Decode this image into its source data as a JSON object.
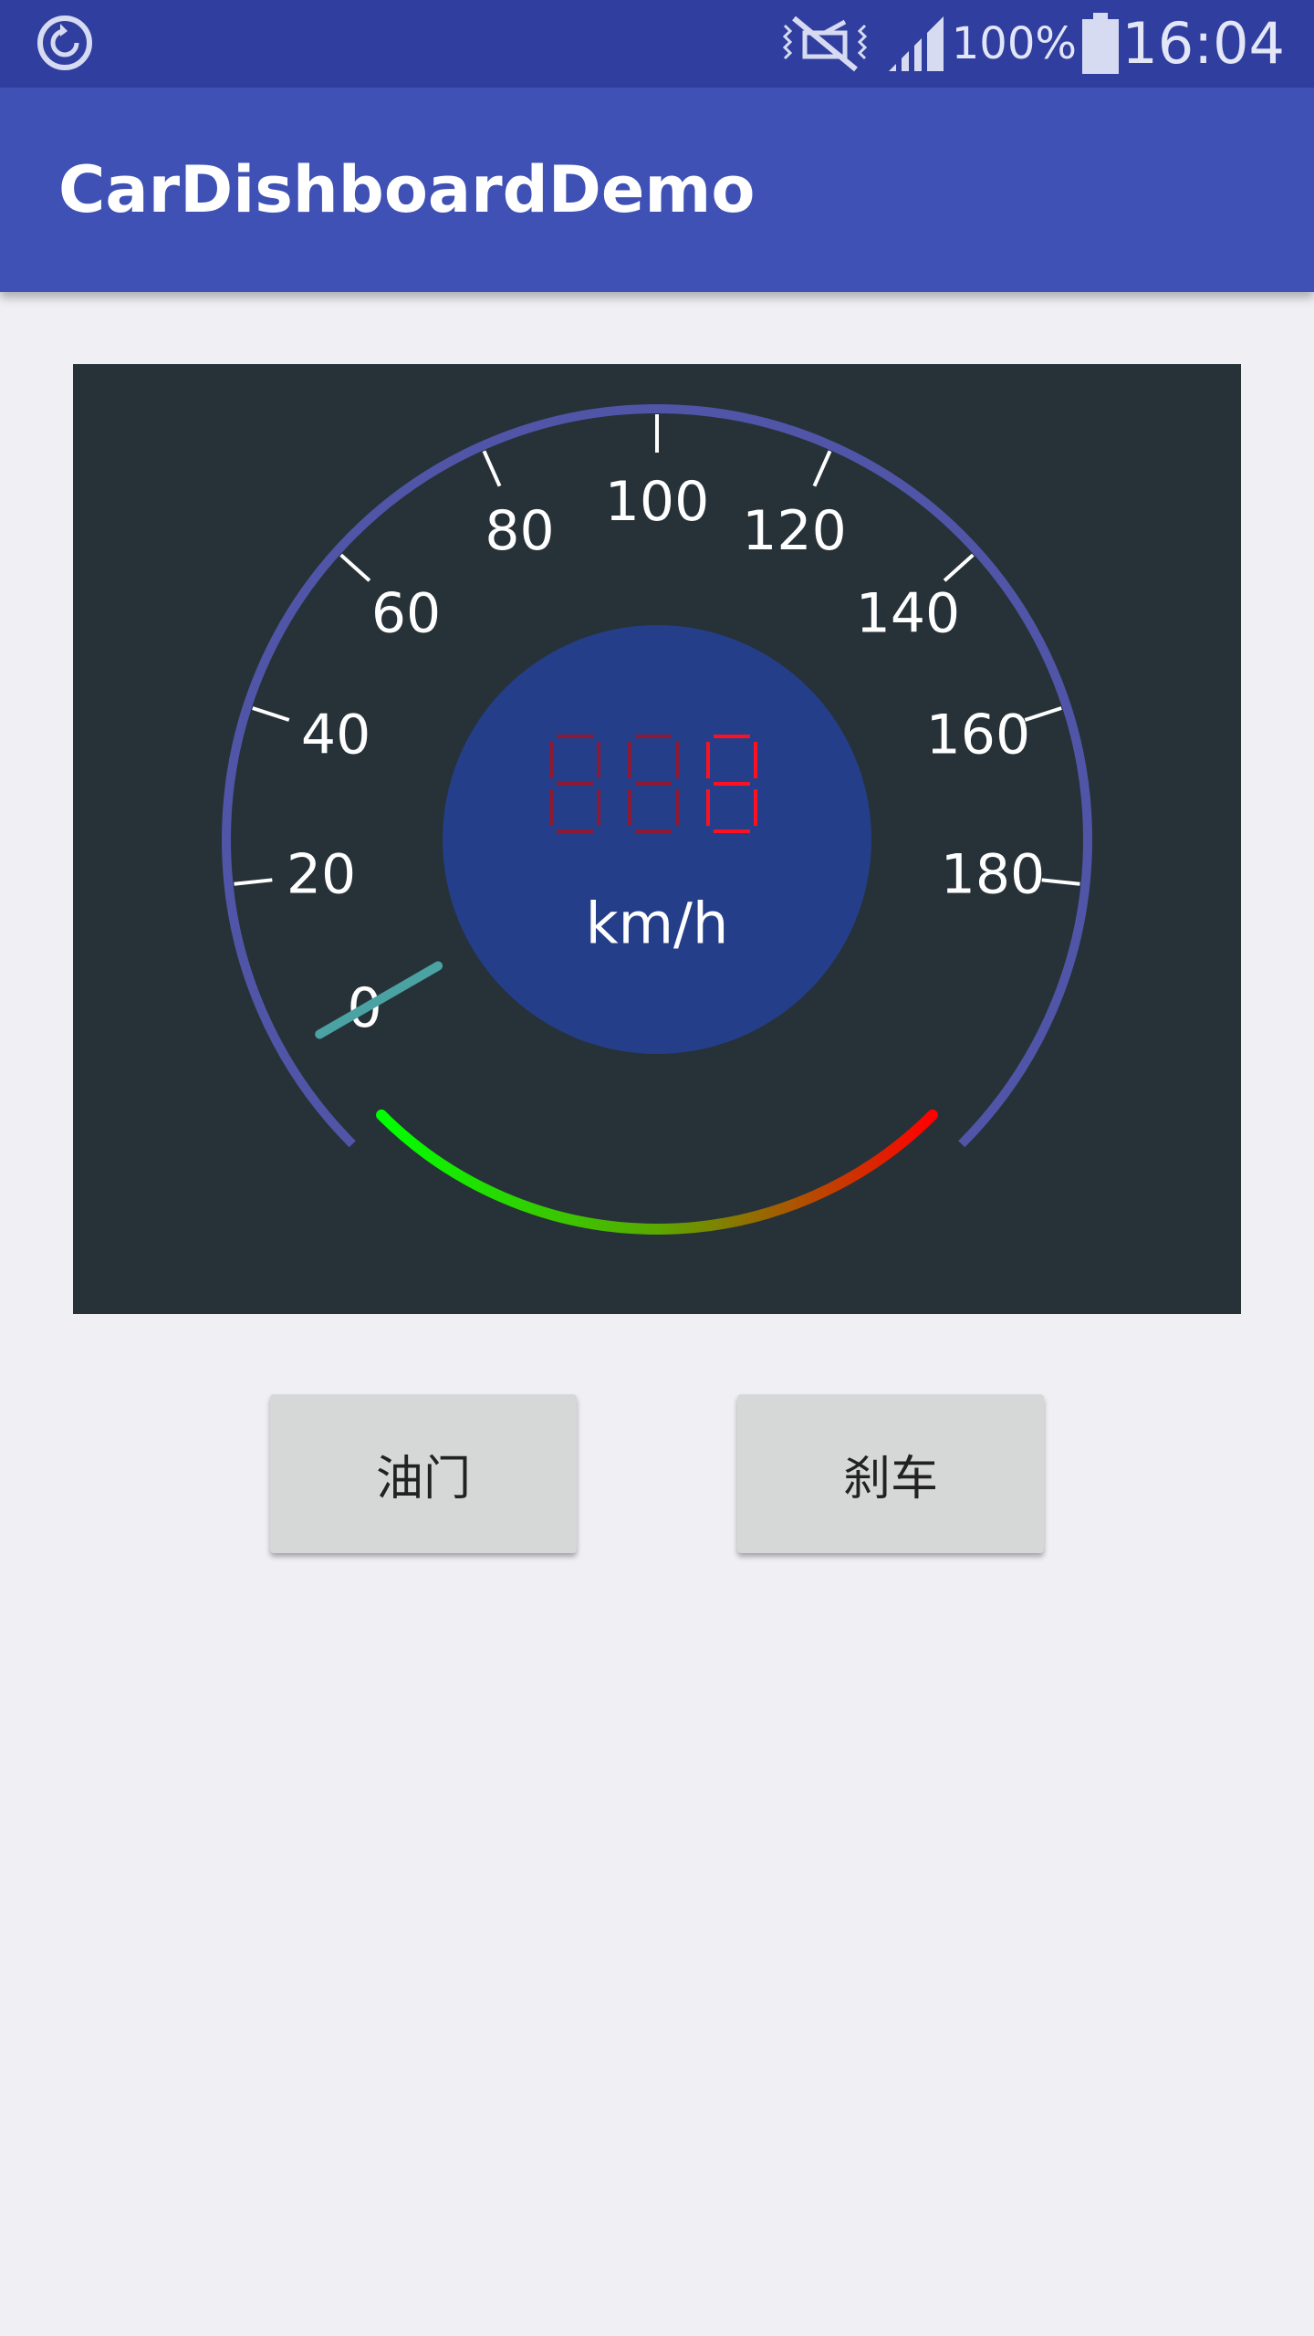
{
  "status_bar": {
    "battery_percent": "100%",
    "time": "16:04",
    "icons": [
      "sync-icon",
      "vibrate-mute-icon",
      "signal-icon",
      "battery-icon"
    ]
  },
  "app_bar": {
    "title": "CarDishboardDemo"
  },
  "dashboard": {
    "ticks": [
      "0",
      "20",
      "40",
      "60",
      "80",
      "100",
      "120",
      "140",
      "160",
      "180"
    ],
    "unit": "km/h",
    "digital_readout": "",
    "speed_value": 0,
    "colors": {
      "background": "#263238",
      "outer_ring": "#5155a8",
      "center_disc": "#243e8a",
      "needle": "#4aa3a2",
      "arc_start": "#00ff00",
      "arc_end": "#ff0000",
      "segment_dim": "#8a1a35",
      "segment_lit": "#ff1020"
    }
  },
  "buttons": {
    "throttle_label": "油门",
    "brake_label": "刹车"
  }
}
